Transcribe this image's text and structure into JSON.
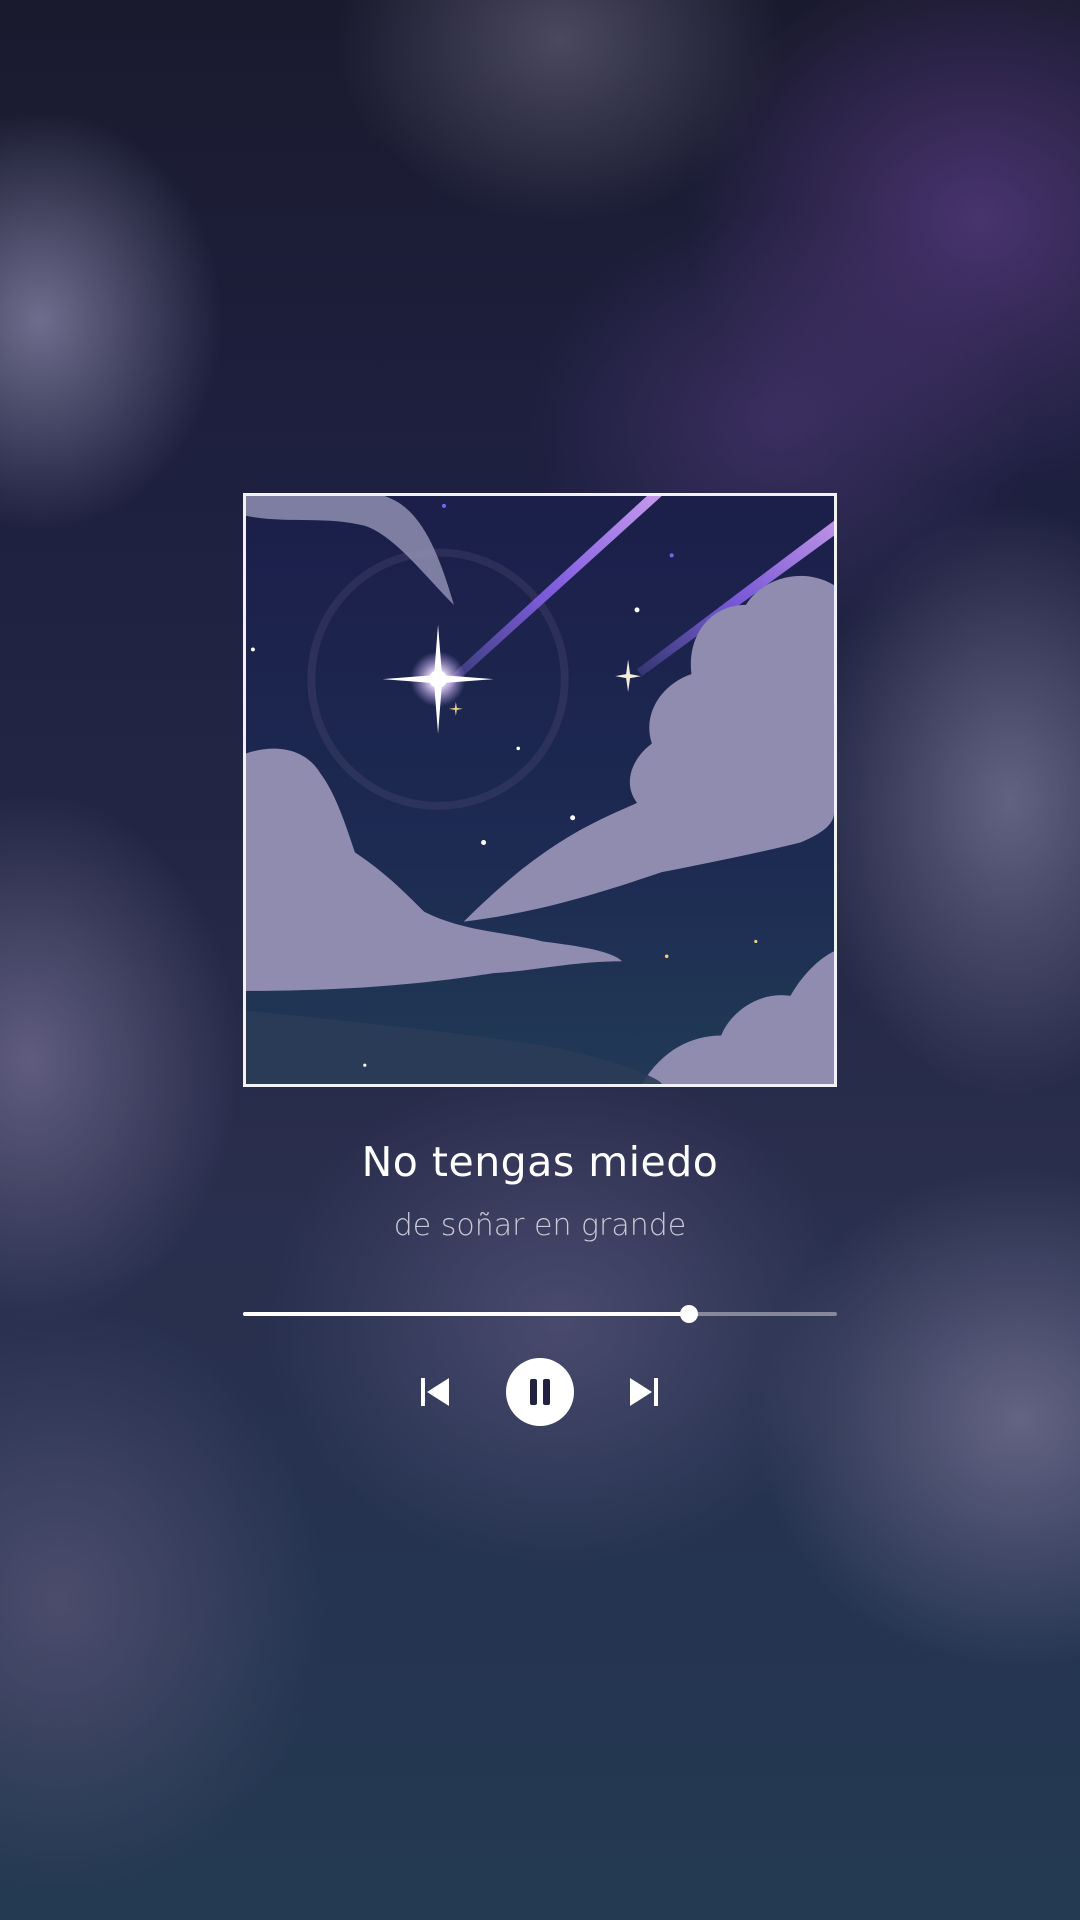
{
  "player": {
    "title": "No tengas miedo",
    "subtitle": "de soñar en grande",
    "progress_fraction": 0.75,
    "album_art": {
      "description_icon": "night-sky-shooting-star-artwork"
    },
    "controls": {
      "previous_icon": "skip-previous-icon",
      "play_pause_icon": "pause-icon",
      "next_icon": "skip-next-icon"
    }
  },
  "colors": {
    "accent": "#ffffff",
    "track": "#b8b8c4",
    "background": "#1f2340"
  }
}
